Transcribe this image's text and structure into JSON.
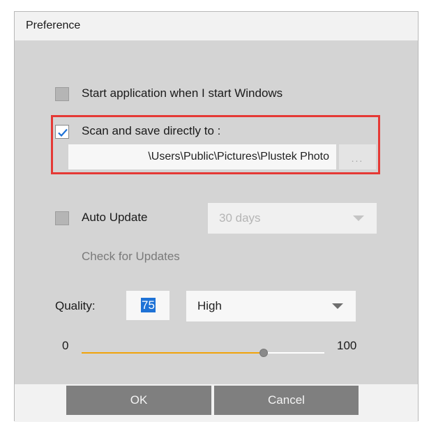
{
  "dialog": {
    "title": "Preference"
  },
  "options": {
    "start_with_windows": {
      "label": "Start application when I start Windows",
      "checked": false
    },
    "scan_save": {
      "label": "Scan and save directly to :",
      "checked": true,
      "path": "\\Users\\Public\\Pictures\\Plustek Photo",
      "browse_label": "..."
    },
    "auto_update": {
      "label": "Auto Update",
      "checked": false,
      "interval": "30 days",
      "check_label": "Check for Updates"
    }
  },
  "quality": {
    "label": "Quality:",
    "value": "75",
    "preset": "High",
    "slider_min": "0",
    "slider_max": "100",
    "slider_fraction": 0.75
  },
  "buttons": {
    "ok": "OK",
    "cancel": "Cancel"
  },
  "colors": {
    "highlight": "#e53935",
    "slider_fill": "#f0a30a",
    "selection": "#1e72d6"
  }
}
